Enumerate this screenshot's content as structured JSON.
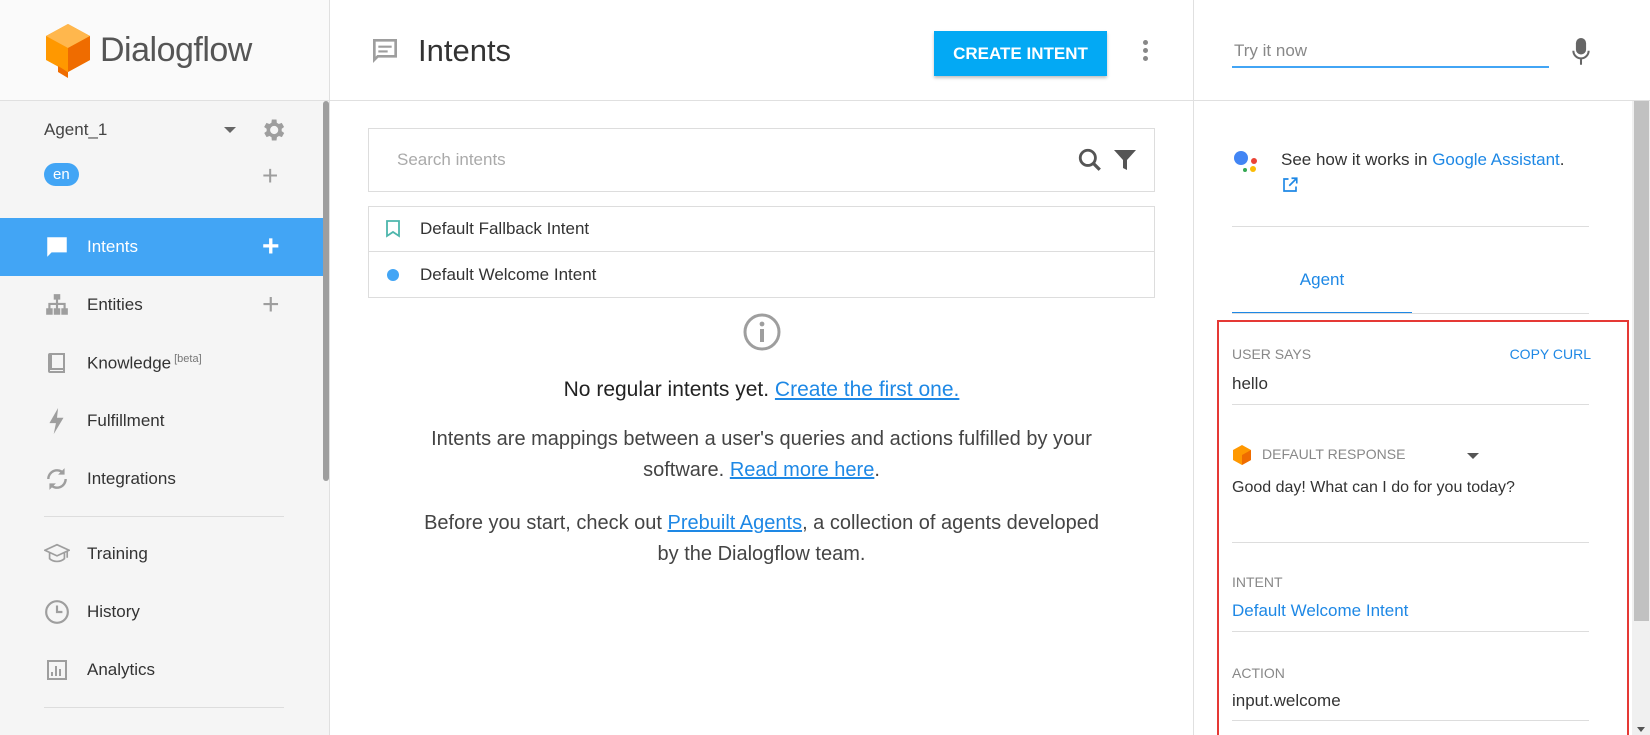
{
  "app": {
    "brand": "Dialogflow"
  },
  "sidebar": {
    "agent_name": "Agent_1",
    "language": "en",
    "items": [
      {
        "label": "Intents",
        "icon": "chat-bubble-icon",
        "has_add": true,
        "active": true
      },
      {
        "label": "Entities",
        "icon": "hierarchy-icon",
        "has_add": true
      },
      {
        "label": "Knowledge",
        "badge": "[beta]",
        "icon": "book-icon"
      },
      {
        "label": "Fulfillment",
        "icon": "lightning-icon"
      },
      {
        "label": "Integrations",
        "icon": "sync-icon"
      },
      {
        "label": "Training",
        "icon": "graduation-cap-icon"
      },
      {
        "label": "History",
        "icon": "clock-icon"
      },
      {
        "label": "Analytics",
        "icon": "bar-chart-icon"
      }
    ]
  },
  "main": {
    "title": "Intents",
    "create_button": "CREATE INTENT",
    "search_placeholder": "Search intents",
    "intents": [
      {
        "label": "Default Fallback Intent",
        "icon": "bookmark-icon"
      },
      {
        "label": "Default Welcome Intent",
        "icon": "dot-icon"
      }
    ],
    "empty": {
      "title": "No regular intents yet.",
      "title_link": "Create the first one.",
      "p1_before": "Intents are mappings between a user's queries and actions fulfilled by your software.",
      "p1_link": "Read more here",
      "p1_after": ".",
      "p2_before": "Before you start, check out",
      "p2_link": "Prebuilt Agents",
      "p2_after": ", a collection of agents developed by the Dialogflow team."
    }
  },
  "right": {
    "try_placeholder": "Try it now",
    "ga_text": "See how it works in",
    "ga_link": "Google Assistant",
    "ga_after": ".",
    "tab": "Agent",
    "user_says_label": "USER SAYS",
    "copy_curl": "COPY CURL",
    "user_says_value": "hello",
    "default_response_label": "DEFAULT RESPONSE",
    "default_response_value": "Good day! What can I do for you today?",
    "intent_label": "INTENT",
    "intent_value": "Default Welcome Intent",
    "action_label": "ACTION",
    "action_value": "input.welcome"
  },
  "colors": {
    "accent": "#42a5f5",
    "button": "#03a9f4",
    "link": "#1e88e5",
    "highlight_border": "#e53935",
    "brand_orange": "#ff9800"
  }
}
